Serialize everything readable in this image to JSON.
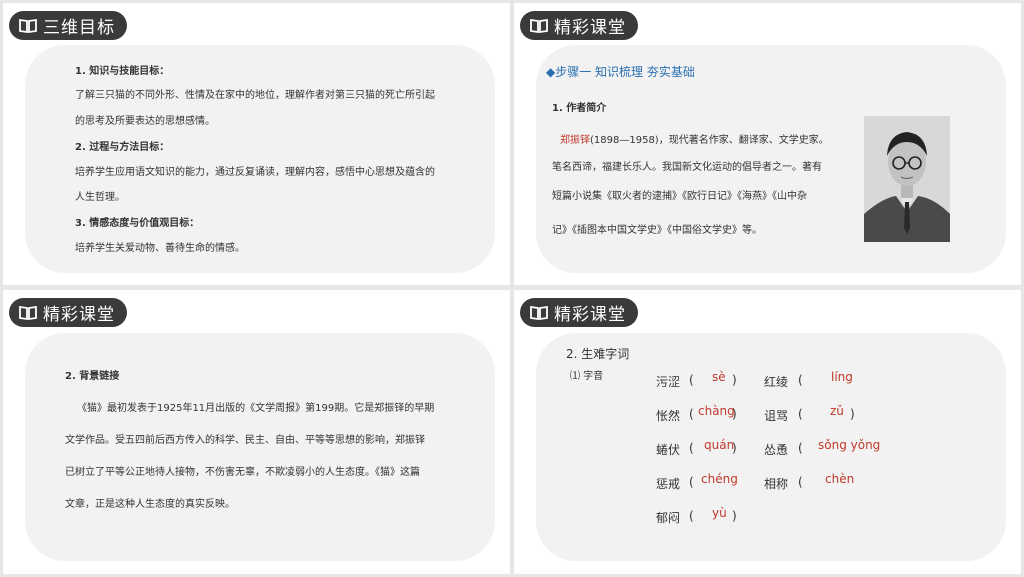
{
  "panel1": {
    "tag": "三维目标",
    "lines": [
      "1. 知识与技能目标：",
      "了解三只猫的不同外形、性情及在家中的地位，理解作者对第三只猫的死亡所引起",
      "的思考及所要表达的思想感情。",
      "2. 过程与方法目标：",
      "培养学生应用语文知识的能力，通过反复诵读，理解内容，感悟中心思想及蕴含的",
      "人生哲理。",
      "3. 情感态度与价值观目标：",
      "培养学生关爱动物、善待生命的情感。"
    ]
  },
  "panel2": {
    "tag": "精彩课堂",
    "step": "◆步骤一  知识梳理  夯实基础",
    "heading": "1. 作者简介",
    "author_name": "郑振铎",
    "line1_rest": "(1898—1958)，现代著名作家、翻译家、文学史家。",
    "lines": [
      "笔名西谛，福建长乐人。我国新文化运动的倡导者之一。著有",
      "短篇小说集《取火者的逮捕》《欧行日记》《海燕》《山中杂",
      "记》《插图本中国文学史》《中国俗文学史》等。"
    ]
  },
  "panel3": {
    "tag": "精彩课堂",
    "heading": "2. 背景链接",
    "lines": [
      "《猫》最初发表于1925年11月出版的《文学周报》第199期。它是郑振铎的早期",
      "文学作品。受五四前后西方传入的科学、民主、自由、平等等思想的影响，郑振铎",
      "已树立了平等公正地待人接物，不伤害无辜，不欺凌弱小的人生态度。《猫》这篇",
      "文章，正是这种人生态度的真实反映。"
    ]
  },
  "panel4": {
    "tag": "精彩课堂",
    "heading": "2. 生难字词",
    "sub": "⑴ 字音",
    "words": [
      {
        "word": "污涩",
        "pinyin": "sè"
      },
      {
        "word": "红绫",
        "pinyin": "líng"
      },
      {
        "word": "怅然",
        "pinyin": "chàng"
      },
      {
        "word": "诅骂",
        "pinyin": "zǔ"
      },
      {
        "word": "蜷伏",
        "pinyin": "quán"
      },
      {
        "word": "怂恿",
        "pinyin": "sǒng yǒng"
      },
      {
        "word": "惩戒",
        "pinyin": "chéng"
      },
      {
        "word": "相称",
        "pinyin": "chèn"
      },
      {
        "word": "郁闷",
        "pinyin": "yù"
      }
    ]
  }
}
